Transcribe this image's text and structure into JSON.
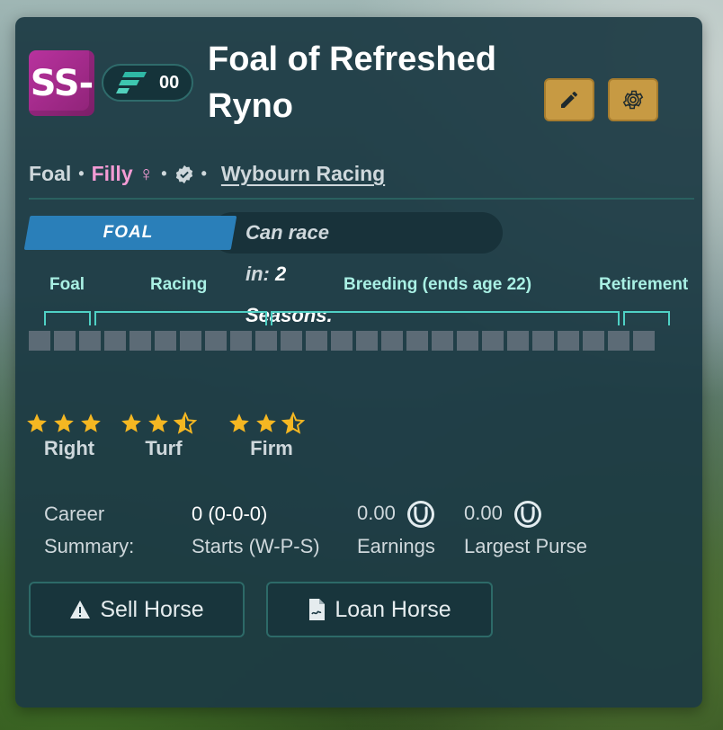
{
  "horse": {
    "grade": "SS-",
    "level": "00",
    "name": "Foal of Refreshed Ryno"
  },
  "meta": {
    "age_class": "Foal",
    "gender": "Filly ♀",
    "owner": "Wybourn Racing"
  },
  "stage": {
    "tag": "FOAL",
    "can_race_prefix": "Can race in: ",
    "can_race_value": "2 Seasons."
  },
  "timeline": {
    "phases": [
      "Foal",
      "Racing",
      "Breeding (ends age 22)",
      "Retirement"
    ],
    "cell_count": 25
  },
  "ratings": [
    {
      "label": "Right",
      "stars": 3
    },
    {
      "label": "Turf",
      "stars": 2.5
    },
    {
      "label": "Firm",
      "stars": 2.5
    }
  ],
  "career": {
    "label_line1": "Career",
    "label_line2": "Summary:",
    "starts_value": "0 (0-0-0)",
    "starts_label": "Starts (W-P-S)",
    "earnings_value": "0.00",
    "earnings_label": "Earnings",
    "purse_value": "0.00",
    "purse_label": "Largest Purse"
  },
  "actions": {
    "sell_label": "Sell Horse",
    "loan_label": "Loan Horse"
  },
  "colors": {
    "accent_gold": "#c79a43",
    "grade_purple": "#a52b8c",
    "filly_pink": "#f39bd4",
    "stage_blue": "#2a7fb9",
    "bracket_teal": "#4fd1c5",
    "star_gold": "#f5b722"
  },
  "icons": {
    "edit": "pencil-icon",
    "settings": "gear-icon",
    "verified": "verified-badge-icon",
    "coin": "horseshoe-coin-icon",
    "sell": "warning-icon",
    "loan": "document-icon"
  }
}
